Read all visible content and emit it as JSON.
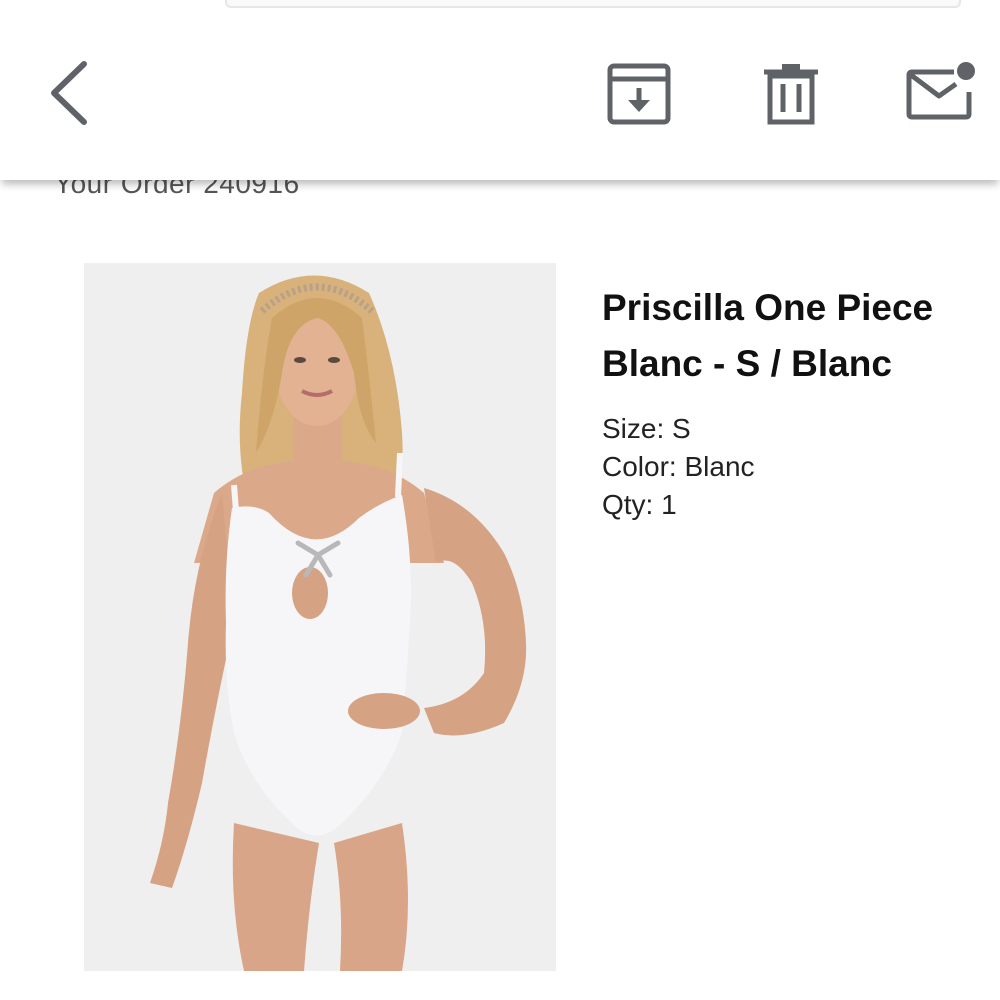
{
  "toolbar": {
    "back_icon": "chevron-left-icon",
    "archive_icon": "archive-icon",
    "trash_icon": "trash-icon",
    "mail_icon": "mail-unread-icon",
    "icon_color": "#5f6368"
  },
  "order": {
    "heading": "Your Order 240916"
  },
  "product": {
    "image_alt": "Model wearing white one-piece swimsuit with keyhole cutout and bow",
    "title_line1": "Priscilla One Piece",
    "title_line2": "Blanc - S / Blanc",
    "size_label": "Size: S",
    "color_label": "Color: Blanc",
    "qty_label": "Qty: 1"
  }
}
